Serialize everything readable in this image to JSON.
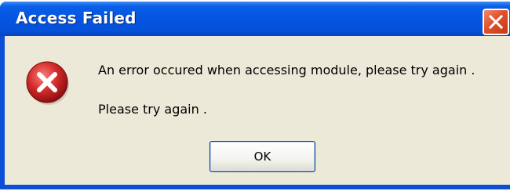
{
  "window": {
    "title": "Access Failed"
  },
  "dialog": {
    "message": "An error occured when accessing module, please try again .",
    "sub_message": "Please try again .",
    "ok_label": "OK",
    "icon": "error-icon"
  },
  "colors": {
    "titlebar": "#0555e2",
    "client_bg": "#ece9d8",
    "close_button": "#e0512b",
    "error_icon": "#d42a2a"
  }
}
